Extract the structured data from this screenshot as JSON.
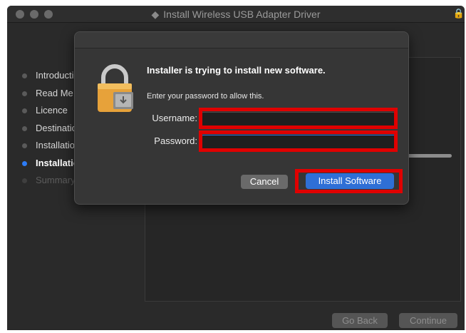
{
  "window": {
    "title": "Install Wireless USB Adapter Driver"
  },
  "sidebar": {
    "items": [
      {
        "label": "Introduction",
        "state": "done"
      },
      {
        "label": "Read Me",
        "state": "done"
      },
      {
        "label": "Licence",
        "state": "done"
      },
      {
        "label": "Destination Select",
        "state": "done"
      },
      {
        "label": "Installation Type",
        "state": "done"
      },
      {
        "label": "Installation",
        "state": "active"
      },
      {
        "label": "Summary",
        "state": "pending"
      }
    ]
  },
  "footer": {
    "go_back": "Go Back",
    "continue": "Continue"
  },
  "dialog": {
    "heading": "Installer is trying to install new software.",
    "subtitle": "Enter your password to allow this.",
    "username_label": "Username:",
    "username_value": "",
    "password_label": "Password:",
    "password_value": "",
    "cancel": "Cancel",
    "install": "Install Software",
    "icon": "lock-icon"
  },
  "colors": {
    "accent": "#2f6fd6",
    "highlight": "#e00000",
    "active_dot": "#2d7cf6"
  }
}
